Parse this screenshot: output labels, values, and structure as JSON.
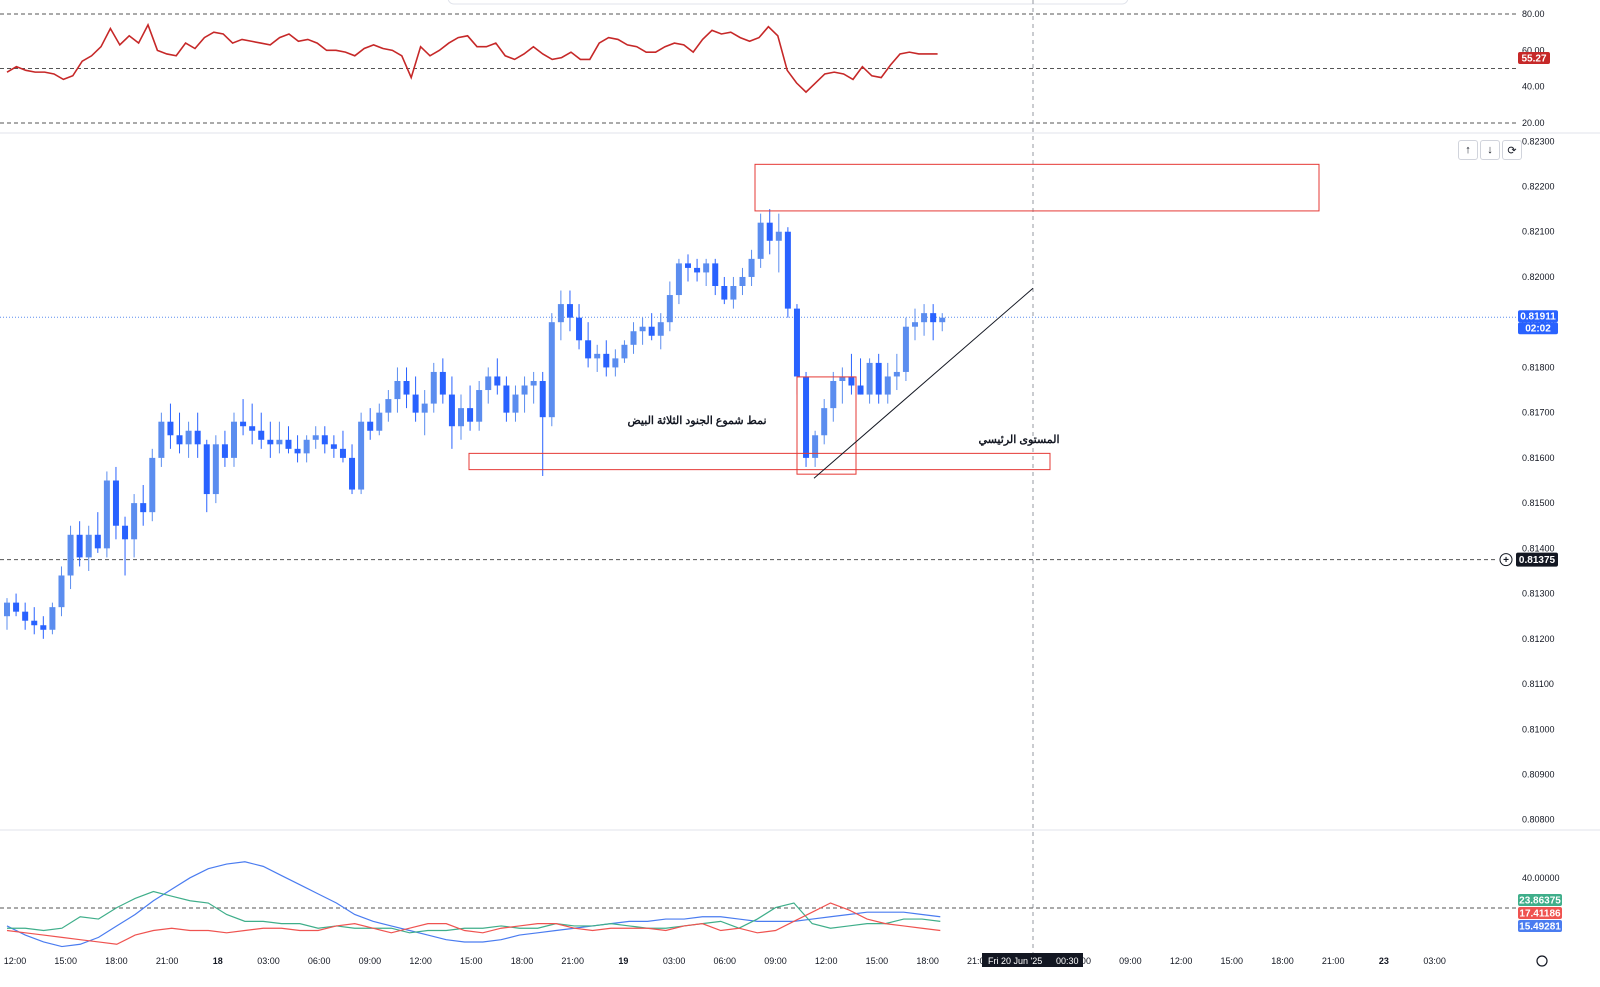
{
  "colors": {
    "bull": "#5b8def",
    "bear": "#2962ff",
    "rsi": "#c62828",
    "adx": "#4a7cf0",
    "di_plus": "#3fae8a",
    "di_minus": "#ef5350",
    "zone": "#e53935",
    "price_badge": "#2962ff",
    "grid_dash": "#555555"
  },
  "controls": {
    "up_icon": "↑",
    "down_icon": "↓",
    "reset_icon": "⟳"
  },
  "annotations": {
    "pattern_label": "نمط شموع الجنود الثلاثة البيض",
    "key_level_label": "المستوى الرئيسي"
  },
  "crosshair": {
    "time_label": "Fri 20 Jun '25",
    "time_suffix": "00:30"
  },
  "chart_data": [
    {
      "type": "line",
      "name_of_panel": "RSI",
      "y_ticks": [
        "80.00",
        "60.00",
        "40.00",
        "20.00"
      ],
      "ylim": [
        20,
        80
      ],
      "last_value": "55.27",
      "values": [
        48,
        51,
        49,
        48,
        48,
        47,
        44,
        46,
        54,
        57,
        62,
        72,
        63,
        68,
        64,
        74,
        60,
        58,
        57,
        64,
        61,
        67,
        70,
        69,
        64,
        66,
        65,
        64,
        63,
        67,
        69,
        65,
        66,
        64,
        60,
        60,
        59,
        57,
        61,
        63,
        61,
        60,
        57,
        45,
        62,
        57,
        60,
        64,
        67,
        68,
        62,
        62,
        64,
        57,
        55,
        58,
        62,
        58,
        55,
        56,
        59,
        55,
        55,
        64,
        67,
        66,
        63,
        62,
        59,
        59,
        62,
        64,
        63,
        59,
        66,
        71,
        69,
        70,
        67,
        65,
        67,
        73,
        68,
        49,
        42,
        37,
        42,
        47,
        48,
        47,
        44,
        51,
        46,
        45,
        52,
        58,
        59,
        58,
        58,
        58
      ]
    },
    {
      "type": "candlestick",
      "name_of_panel": "price",
      "y_ticks": [
        "0.82300",
        "0.82200",
        "0.82100",
        "0.82000",
        "0.81900",
        "0.81800",
        "0.81700",
        "0.81600",
        "0.81500",
        "0.81400",
        "0.81300",
        "0.81200",
        "0.81100",
        "0.81000",
        "0.80900",
        "0.80800"
      ],
      "ylim": [
        0.80795,
        0.82305
      ],
      "x_ticks": [
        "12:00",
        "15:00",
        "18:00",
        "21:00",
        "18",
        "03:00",
        "06:00",
        "09:00",
        "12:00",
        "15:00",
        "18:00",
        "21:00",
        "19",
        "03:00",
        "06:00",
        "09:00",
        "12:00",
        "15:00",
        "18:00",
        "21:00",
        "00:30",
        "06:00",
        "09:00",
        "12:00",
        "15:00",
        "18:00",
        "21:00",
        "23",
        "03:00"
      ],
      "current_price": "0.81911",
      "countdown": "02:02",
      "horizontal_level": "0.81375",
      "candles": [
        [
          0.8125,
          0.8129,
          0.8122,
          0.8128
        ],
        [
          0.8128,
          0.813,
          0.8125,
          0.8126
        ],
        [
          0.8126,
          0.8128,
          0.8122,
          0.8124
        ],
        [
          0.8124,
          0.8127,
          0.8121,
          0.8123
        ],
        [
          0.8123,
          0.8125,
          0.812,
          0.8122
        ],
        [
          0.8122,
          0.8128,
          0.8121,
          0.8127
        ],
        [
          0.8127,
          0.8136,
          0.8125,
          0.8134
        ],
        [
          0.8134,
          0.8145,
          0.8131,
          0.8143
        ],
        [
          0.8143,
          0.8146,
          0.8136,
          0.8138
        ],
        [
          0.8138,
          0.8145,
          0.8135,
          0.8143
        ],
        [
          0.8143,
          0.8148,
          0.8139,
          0.814
        ],
        [
          0.814,
          0.8157,
          0.8138,
          0.8155
        ],
        [
          0.8155,
          0.8158,
          0.8142,
          0.8145
        ],
        [
          0.8145,
          0.8147,
          0.8134,
          0.8142
        ],
        [
          0.8142,
          0.8152,
          0.8138,
          0.815
        ],
        [
          0.815,
          0.8154,
          0.8145,
          0.8148
        ],
        [
          0.8148,
          0.8162,
          0.8146,
          0.816
        ],
        [
          0.816,
          0.817,
          0.8158,
          0.8168
        ],
        [
          0.8168,
          0.8172,
          0.8162,
          0.8165
        ],
        [
          0.8165,
          0.817,
          0.8161,
          0.8163
        ],
        [
          0.8163,
          0.8168,
          0.816,
          0.8166
        ],
        [
          0.8166,
          0.817,
          0.816,
          0.8163
        ],
        [
          0.8163,
          0.8164,
          0.8148,
          0.8152
        ],
        [
          0.8152,
          0.8165,
          0.815,
          0.8163
        ],
        [
          0.8163,
          0.8166,
          0.8158,
          0.816
        ],
        [
          0.816,
          0.817,
          0.8158,
          0.8168
        ],
        [
          0.8168,
          0.8173,
          0.8165,
          0.8167
        ],
        [
          0.8167,
          0.8172,
          0.8163,
          0.8166
        ],
        [
          0.8166,
          0.817,
          0.8162,
          0.8164
        ],
        [
          0.8164,
          0.8168,
          0.816,
          0.8163
        ],
        [
          0.8163,
          0.8168,
          0.8161,
          0.8164
        ],
        [
          0.8164,
          0.8167,
          0.8161,
          0.8162
        ],
        [
          0.8162,
          0.8165,
          0.8159,
          0.8161
        ],
        [
          0.8161,
          0.8165,
          0.8159,
          0.8164
        ],
        [
          0.8164,
          0.8167,
          0.8162,
          0.8165
        ],
        [
          0.8165,
          0.8167,
          0.8161,
          0.8163
        ],
        [
          0.8163,
          0.8165,
          0.816,
          0.8162
        ],
        [
          0.8162,
          0.8166,
          0.8159,
          0.816
        ],
        [
          0.816,
          0.8163,
          0.8152,
          0.8153
        ],
        [
          0.8153,
          0.817,
          0.8152,
          0.8168
        ],
        [
          0.8168,
          0.8171,
          0.8164,
          0.8166
        ],
        [
          0.8166,
          0.8172,
          0.8165,
          0.817
        ],
        [
          0.817,
          0.8175,
          0.8168,
          0.8173
        ],
        [
          0.8173,
          0.818,
          0.817,
          0.8177
        ],
        [
          0.8177,
          0.818,
          0.8171,
          0.8174
        ],
        [
          0.8174,
          0.8178,
          0.8168,
          0.817
        ],
        [
          0.817,
          0.8175,
          0.8165,
          0.8172
        ],
        [
          0.8172,
          0.8181,
          0.817,
          0.8179
        ],
        [
          0.8179,
          0.8182,
          0.8172,
          0.8174
        ],
        [
          0.8174,
          0.8178,
          0.8162,
          0.8167
        ],
        [
          0.8167,
          0.8174,
          0.8164,
          0.8171
        ],
        [
          0.8171,
          0.8176,
          0.8166,
          0.8168
        ],
        [
          0.8168,
          0.8177,
          0.8166,
          0.8175
        ],
        [
          0.8175,
          0.818,
          0.8172,
          0.8178
        ],
        [
          0.8178,
          0.8182,
          0.8174,
          0.8176
        ],
        [
          0.8176,
          0.8178,
          0.8168,
          0.817
        ],
        [
          0.817,
          0.8176,
          0.8168,
          0.8174
        ],
        [
          0.8174,
          0.8178,
          0.817,
          0.8176
        ],
        [
          0.8176,
          0.8179,
          0.8172,
          0.8177
        ],
        [
          0.8177,
          0.8179,
          0.8156,
          0.8169
        ],
        [
          0.8169,
          0.8192,
          0.8167,
          0.819
        ],
        [
          0.819,
          0.8197,
          0.8186,
          0.8194
        ],
        [
          0.8194,
          0.8197,
          0.8188,
          0.8191
        ],
        [
          0.8191,
          0.8194,
          0.8184,
          0.8186
        ],
        [
          0.8186,
          0.819,
          0.818,
          0.8182
        ],
        [
          0.8182,
          0.8185,
          0.8179,
          0.8183
        ],
        [
          0.8183,
          0.8186,
          0.8178,
          0.818
        ],
        [
          0.818,
          0.8184,
          0.8178,
          0.8182
        ],
        [
          0.8182,
          0.8186,
          0.8181,
          0.8185
        ],
        [
          0.8185,
          0.819,
          0.8183,
          0.8188
        ],
        [
          0.8188,
          0.8191,
          0.8185,
          0.8189
        ],
        [
          0.8189,
          0.8192,
          0.8186,
          0.8187
        ],
        [
          0.8187,
          0.8192,
          0.8184,
          0.819
        ],
        [
          0.819,
          0.8199,
          0.8188,
          0.8196
        ],
        [
          0.8196,
          0.8204,
          0.8194,
          0.8203
        ],
        [
          0.8203,
          0.8205,
          0.8199,
          0.8202
        ],
        [
          0.8202,
          0.8204,
          0.8199,
          0.8201
        ],
        [
          0.8201,
          0.8204,
          0.8198,
          0.8203
        ],
        [
          0.8203,
          0.8204,
          0.8196,
          0.8198
        ],
        [
          0.8198,
          0.82,
          0.8194,
          0.8195
        ],
        [
          0.8195,
          0.82,
          0.8193,
          0.8198
        ],
        [
          0.8198,
          0.8202,
          0.8196,
          0.82
        ],
        [
          0.82,
          0.8206,
          0.8198,
          0.8204
        ],
        [
          0.8204,
          0.8214,
          0.8202,
          0.8212
        ],
        [
          0.8212,
          0.8215,
          0.8205,
          0.8208
        ],
        [
          0.8208,
          0.8214,
          0.8201,
          0.821
        ],
        [
          0.821,
          0.8211,
          0.8191,
          0.8193
        ],
        [
          0.8193,
          0.8194,
          0.8174,
          0.8178
        ],
        [
          0.8178,
          0.8179,
          0.8158,
          0.816
        ],
        [
          0.816,
          0.8166,
          0.8158,
          0.8165
        ],
        [
          0.8165,
          0.8173,
          0.8163,
          0.8171
        ],
        [
          0.8171,
          0.8179,
          0.8168,
          0.8177
        ],
        [
          0.8177,
          0.818,
          0.8172,
          0.8178
        ],
        [
          0.8178,
          0.8183,
          0.8174,
          0.8176
        ],
        [
          0.8176,
          0.8182,
          0.8174,
          0.8174
        ],
        [
          0.8174,
          0.8182,
          0.8172,
          0.8181
        ],
        [
          0.8181,
          0.8183,
          0.8172,
          0.8174
        ],
        [
          0.8174,
          0.8181,
          0.8172,
          0.8178
        ],
        [
          0.8178,
          0.8183,
          0.8175,
          0.8179
        ],
        [
          0.8179,
          0.8191,
          0.8177,
          0.8189
        ],
        [
          0.8189,
          0.8193,
          0.8186,
          0.819
        ],
        [
          0.819,
          0.8194,
          0.8187,
          0.8192
        ],
        [
          0.8192,
          0.8194,
          0.8186,
          0.819
        ],
        [
          0.819,
          0.8192,
          0.8188,
          0.8191
        ]
      ]
    },
    {
      "type": "line",
      "name_of_panel": "ADX / DMI",
      "y_ticks": [
        "40.00000"
      ],
      "ylim": [
        5,
        60
      ],
      "last_values": [
        "23.86375",
        "17.41186",
        "15.49281"
      ],
      "series": [
        {
          "color_key": "adx",
          "values": [
            19,
            15,
            12,
            10,
            11,
            14,
            19,
            24,
            30,
            35,
            40,
            44,
            46,
            47,
            45,
            41,
            37,
            33,
            29,
            24,
            21,
            19,
            17,
            15,
            13,
            12,
            12,
            13,
            15,
            16,
            17,
            18,
            19,
            20,
            21,
            21,
            22,
            22,
            23,
            23,
            22,
            21,
            21,
            21,
            22,
            23,
            24,
            25,
            25,
            25,
            24,
            23
          ]
        },
        {
          "color_key": "di_plus",
          "values": [
            18,
            18,
            17,
            18,
            23,
            22,
            27,
            31,
            34,
            32,
            30,
            29,
            24,
            21,
            21,
            20,
            20,
            18,
            19,
            18,
            18,
            18,
            16,
            17,
            17,
            18,
            18,
            19,
            18,
            18,
            20,
            19,
            19,
            20,
            19,
            18,
            18,
            19,
            20,
            21,
            18,
            22,
            27,
            29,
            20,
            18,
            19,
            20,
            20,
            22,
            22,
            21
          ]
        },
        {
          "color_key": "di_minus",
          "values": [
            17,
            16,
            15,
            14,
            13,
            12,
            11,
            15,
            17,
            18,
            17,
            17,
            16,
            17,
            18,
            18,
            17,
            17,
            19,
            20,
            18,
            16,
            18,
            20,
            20,
            17,
            16,
            18,
            19,
            20,
            20,
            18,
            17,
            18,
            18,
            18,
            17,
            19,
            20,
            17,
            18,
            16,
            17,
            21,
            25,
            29,
            26,
            22,
            20,
            19,
            18,
            17
          ]
        }
      ]
    }
  ]
}
